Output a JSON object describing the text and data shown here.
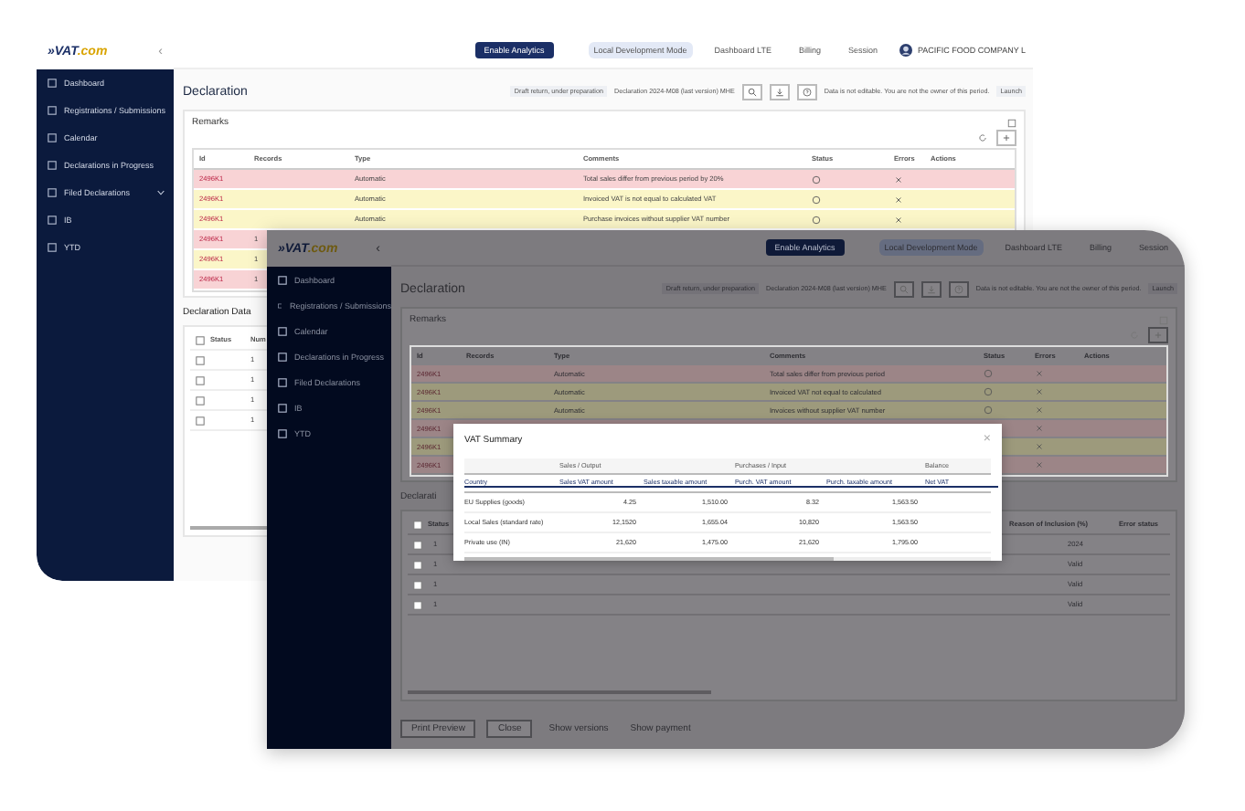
{
  "back": {
    "logo": {
      "main": "»VAT",
      "suffix": ".com"
    },
    "collapse": "‹",
    "enable_button": "Enable Analytics",
    "nav": [
      {
        "label": "Local Development Mode",
        "selected": true
      },
      {
        "label": "Dashboard LTE",
        "selected": false
      },
      {
        "label": "Billing",
        "selected": false
      },
      {
        "label": "Session",
        "selected": false
      }
    ],
    "account": "PACIFIC FOOD COMPANY L",
    "sidebar": [
      {
        "label": "Dashboard",
        "expandable": false
      },
      {
        "label": "Registrations / Submissions",
        "expandable": false
      },
      {
        "label": "Calendar",
        "expandable": false
      },
      {
        "label": "Declarations in Progress",
        "expandable": false
      },
      {
        "label": "Filed Declarations",
        "expandable": true
      },
      {
        "label": "IB",
        "expandable": false
      },
      {
        "label": "YTD",
        "expandable": false
      }
    ],
    "title": "Declaration",
    "status_chip": "Draft return, under preparation",
    "period": "Declaration 2024-M08 (last version) MHE",
    "notice": "Data is not editable. You are not the owner of this period.",
    "action": "Launch",
    "remarks": {
      "title": "Remarks",
      "columns": [
        "Id",
        "Records",
        "Type",
        "Comments",
        "Status",
        "Errors",
        "Actions"
      ],
      "rows": [
        {
          "id": "2496K1",
          "type": "Automatic",
          "comment": "Total sales differ from previous period by 20%",
          "color": "#f8d3d5"
        },
        {
          "id": "2496K1",
          "type": "Automatic",
          "comment": "Invoiced VAT is not equal to calculated VAT",
          "color": "#fbf6c8"
        },
        {
          "id": "2496K1",
          "type": "Automatic",
          "comment": "Purchase invoices without supplier VAT number",
          "color": "#fbf6c8"
        },
        {
          "id": "2496K1",
          "records": "1",
          "color": "#f8d3d5"
        },
        {
          "id": "2496K1",
          "records": "1",
          "color": "#fbf6c8"
        },
        {
          "id": "2496K1",
          "records": "1",
          "color": "#f8d3d5"
        }
      ]
    },
    "data": {
      "title": "Declaration Data",
      "select_all": false,
      "columns": [
        "Status",
        "Num"
      ],
      "rows": [
        {
          "num": "1",
          "checked": false
        },
        {
          "num": "1",
          "checked": false
        },
        {
          "num": "1",
          "checked": false
        },
        {
          "num": "1",
          "checked": false
        }
      ]
    }
  },
  "front": {
    "dimmed": true,
    "logo": {
      "main": "»VAT",
      "suffix": ".com"
    },
    "collapse": "‹",
    "enable_button": "Enable Analytics",
    "nav": [
      {
        "label": "Local Development Mode",
        "selected": true
      },
      {
        "label": "Dashboard LTE",
        "selected": false
      },
      {
        "label": "Billing",
        "selected": false
      },
      {
        "label": "Session",
        "selected": false
      }
    ],
    "sidebar": [
      {
        "label": "Dashboard",
        "expandable": false
      },
      {
        "label": "Registrations / Submissions",
        "expandable": false
      },
      {
        "label": "Calendar",
        "expandable": false
      },
      {
        "label": "Declarations in Progress",
        "expandable": false
      },
      {
        "label": "Filed Declarations",
        "expandable": false
      },
      {
        "label": "IB",
        "expandable": false
      },
      {
        "label": "YTD",
        "expandable": false
      }
    ],
    "title": "Declaration",
    "status_chip": "Draft return, under preparation",
    "period": "Declaration 2024-M08 (last version) MHE",
    "notice": "Data is not editable. You are not the owner of this period.",
    "action": "Launch",
    "remarks": {
      "title": "Remarks",
      "columns": [
        "Id",
        "Records",
        "Type",
        "Comments",
        "Status",
        "Errors",
        "Actions"
      ],
      "rows": [
        {
          "id": "2496K1",
          "type": "Automatic",
          "comment": "Total sales differ from previous period",
          "color": "#9c8587"
        },
        {
          "id": "2496K1",
          "type": "Automatic",
          "comment": "Invoiced VAT not equal to calculated",
          "color": "#9d9a7c"
        },
        {
          "id": "2496K1",
          "type": "Automatic",
          "comment": "Invoices without supplier VAT number",
          "color": "#9d9a7c"
        },
        {
          "id": "2496K1",
          "color": "#9c8587"
        },
        {
          "id": "2496K1",
          "color": "#9d9a7c"
        },
        {
          "id": "2496K1",
          "color": "#9c8587"
        }
      ]
    },
    "data": {
      "title": "Declarati",
      "select_all": false,
      "columns": [
        "Status",
        "Reason of Inclusion (%)",
        "Error status"
      ],
      "rows": [
        {
          "num": "1",
          "note": "2024",
          "checked": false
        },
        {
          "num": "1",
          "note": "Valid",
          "checked": false
        },
        {
          "num": "1",
          "note": "Valid",
          "checked": false
        },
        {
          "num": "1",
          "note": "Valid",
          "checked": false
        }
      ]
    },
    "buttons": [
      {
        "label": "Print Preview",
        "kind": "outline"
      },
      {
        "label": "Close",
        "kind": "outline"
      },
      {
        "label": "Show versions",
        "kind": "link"
      },
      {
        "label": "Show payment",
        "kind": "link"
      }
    ],
    "modal": {
      "title": "VAT Summary",
      "close": "×",
      "groups": [
        "Sales / Output",
        "Purchases / Input",
        "Balance"
      ],
      "columns": [
        "Country",
        "Sales VAT amount",
        "Sales taxable amount",
        "Purch. VAT amount",
        "Purch. taxable amount",
        "Net VAT"
      ],
      "rows": [
        [
          "EU Supplies (goods)",
          "4.25",
          "1,510.00",
          "8.32",
          "1,563.50"
        ],
        [
          "Local Sales (standard rate)",
          "12,1520",
          "1,655.04",
          "10,820",
          "1,563.50"
        ],
        [
          "Private use (IN)",
          "21,620",
          "1,475.00",
          "21,620",
          "1,795.00"
        ]
      ]
    }
  }
}
